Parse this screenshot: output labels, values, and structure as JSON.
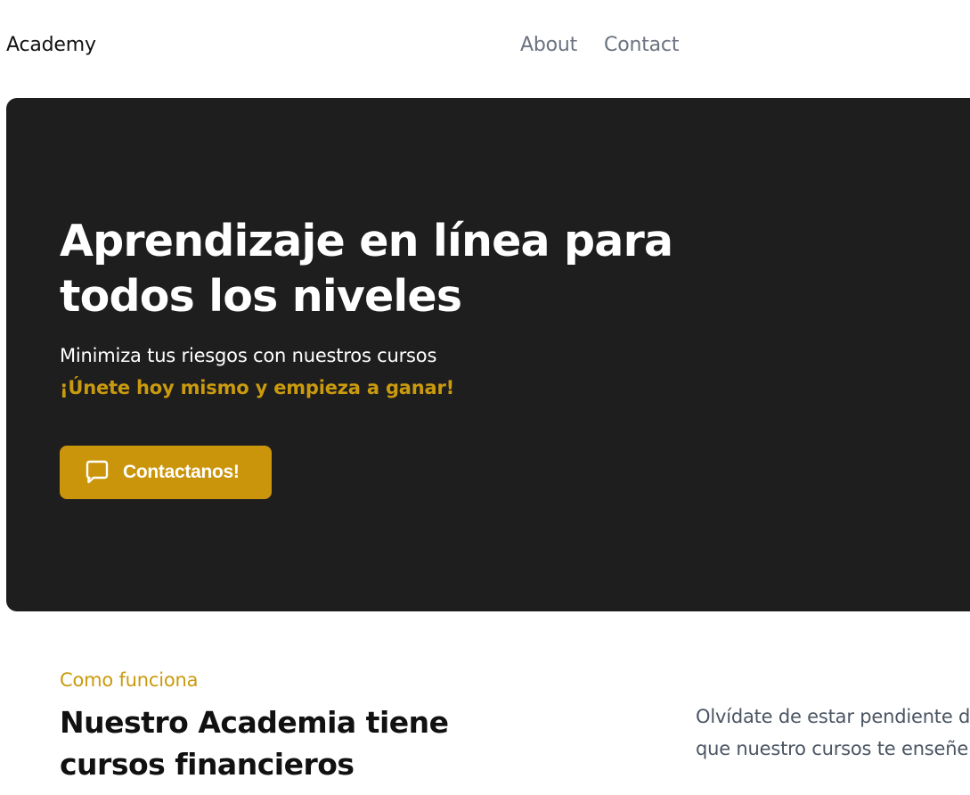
{
  "nav": {
    "brand": "Academy",
    "links": [
      {
        "label": "About"
      },
      {
        "label": "Contact"
      }
    ]
  },
  "hero": {
    "title": "Aprendizaje en línea para todos los niveles",
    "subtitle": "Minimiza tus riesgos con nuestros cursos",
    "highlight": "¡Únete hoy mismo y empieza a ganar!",
    "cta": {
      "label": "Contactanos!",
      "icon": "chat-bubble-icon"
    }
  },
  "how_it_works": {
    "eyebrow": "Como funciona",
    "title": "Nuestro Academia tiene cursos financieros",
    "description_lines": [
      "Olvídate de estar pendiente d",
      "que nuestro cursos te enseñe"
    ]
  },
  "colors": {
    "accent": "#ca950b",
    "hero_bg": "#1e1e1e",
    "muted_text": "#6b7280"
  }
}
